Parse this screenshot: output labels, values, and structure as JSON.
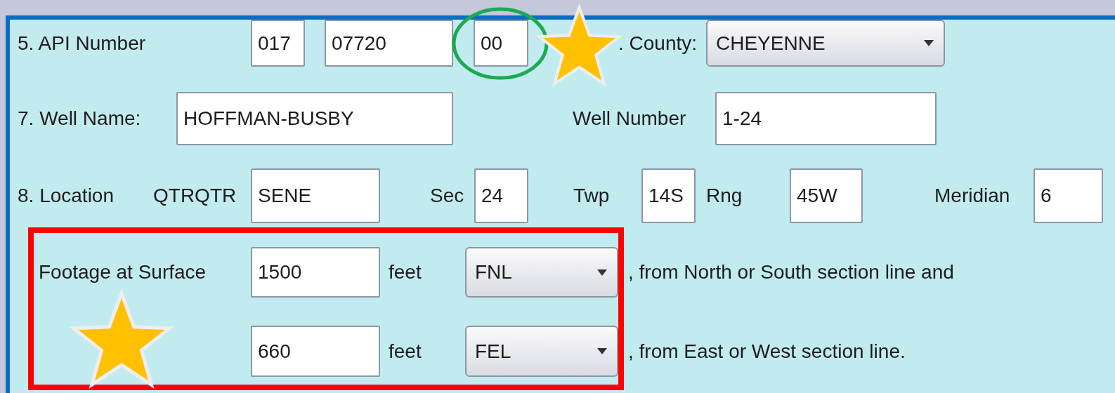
{
  "api_number": {
    "label": "5. API Number",
    "parts": [
      "017",
      "07720",
      "00"
    ]
  },
  "county": {
    "label": ". County:",
    "value": "CHEYENNE"
  },
  "well_name": {
    "label": "7. Well Name:",
    "value": "HOFFMAN-BUSBY"
  },
  "well_number": {
    "label": "Well Number",
    "value": "1-24"
  },
  "location": {
    "label": "8. Location",
    "fields": [
      {
        "label": "QTRQTR",
        "value": "SENE"
      },
      {
        "label": "Sec",
        "value": "24"
      },
      {
        "label": "Twp",
        "value": "14S"
      },
      {
        "label": "Rng",
        "value": "45W"
      },
      {
        "label": "Meridian",
        "value": "6"
      }
    ]
  },
  "footage": {
    "label": "Footage at Surface",
    "rows": [
      {
        "value": "1500",
        "unit": "feet",
        "direction": "FNL",
        "suffix": ", from North or South section line and"
      },
      {
        "value": "660",
        "unit": "feet",
        "direction": "FEL",
        "suffix": ", from East or West section line."
      }
    ]
  },
  "annotations": [
    {
      "kind": "ellipse"
    },
    {
      "kind": "star"
    },
    {
      "kind": "box"
    },
    {
      "kind": "star"
    }
  ]
}
